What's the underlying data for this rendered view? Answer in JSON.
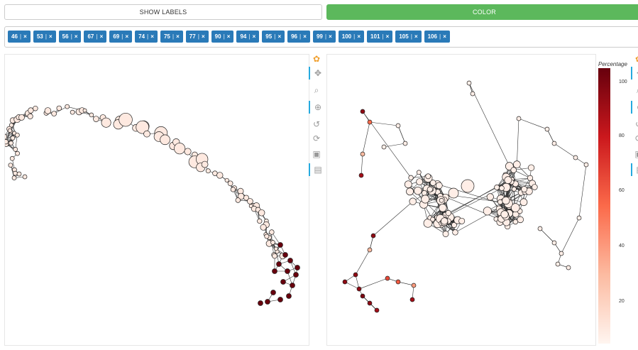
{
  "buttons": {
    "show_labels": "SHOW LABELS",
    "color": "COLOR"
  },
  "tags": [
    "46",
    "53",
    "56",
    "67",
    "69",
    "74",
    "75",
    "77",
    "90",
    "94",
    "95",
    "96",
    "99",
    "100",
    "101",
    "105",
    "106"
  ],
  "tag_remove_glyph": "×",
  "colorbar": {
    "title": "Percentage",
    "ticks": [
      "100",
      "80",
      "60",
      "40",
      "20"
    ],
    "low_color": "#fff5f0",
    "high_color": "#67000d"
  },
  "colors": {
    "accent_green": "#5cb85c",
    "tag_blue": "#2a7ab8",
    "tool_active": "#26aadf"
  },
  "toolbar_icons": [
    "bokeh-logo-icon",
    "pan-icon",
    "box-zoom-icon",
    "wheel-zoom-icon",
    "reset-history-icon",
    "reset-icon",
    "save-icon",
    "hover-icon"
  ]
}
